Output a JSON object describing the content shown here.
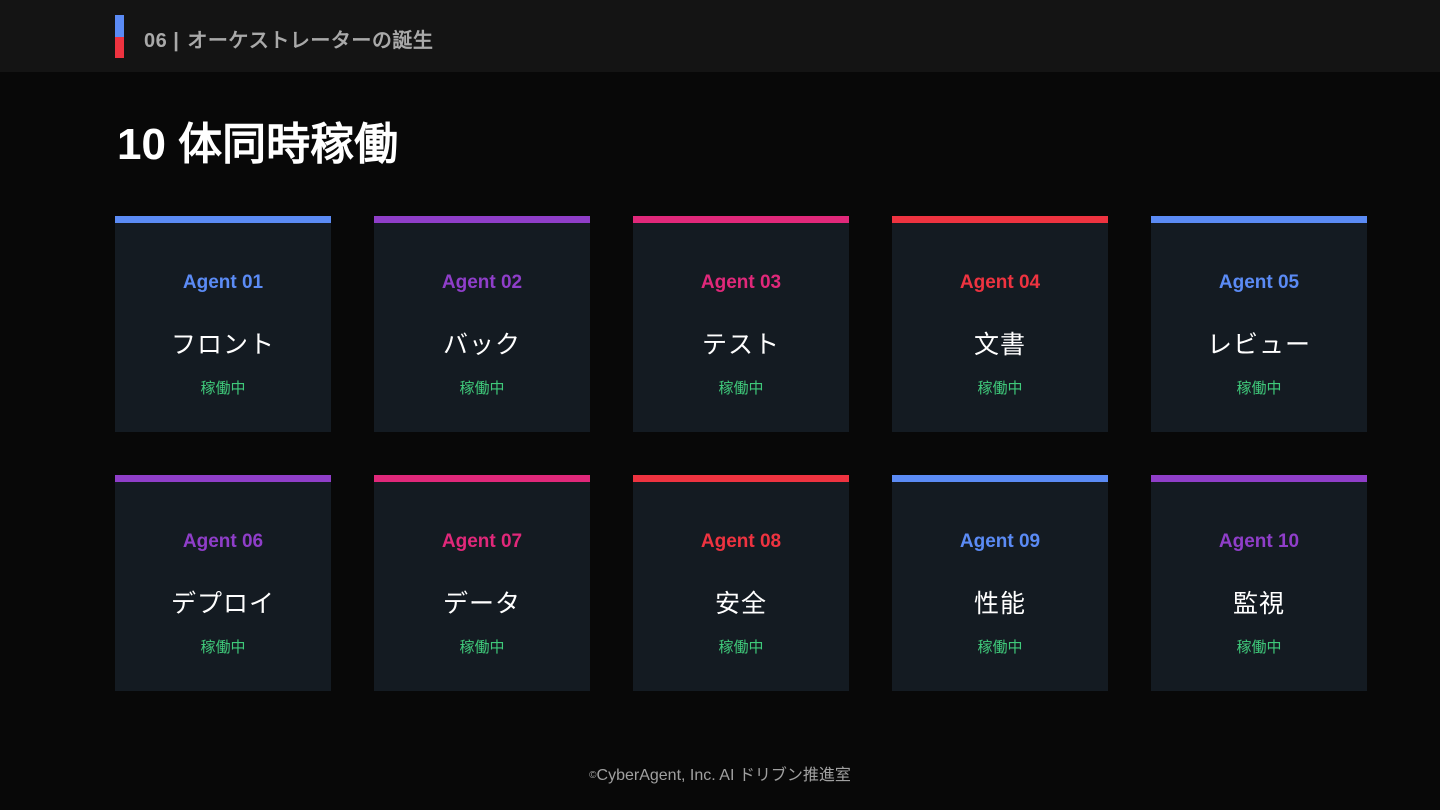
{
  "header": {
    "section_number": "06",
    "separator": "|",
    "section_title": "オーケストレーターの誕生",
    "accent_colors": [
      "#5b8bf5",
      "#ee3340"
    ]
  },
  "title": "10 体同時稼働",
  "agents": [
    {
      "name": "Agent 01",
      "role": "フロント",
      "status": "稼働中",
      "color": "#5b8bf5"
    },
    {
      "name": "Agent 02",
      "role": "バック",
      "status": "稼働中",
      "color": "#8f3ec9"
    },
    {
      "name": "Agent 03",
      "role": "テスト",
      "status": "稼働中",
      "color": "#e0287a"
    },
    {
      "name": "Agent 04",
      "role": "文書",
      "status": "稼働中",
      "color": "#ee3340"
    },
    {
      "name": "Agent 05",
      "role": "レビュー",
      "status": "稼働中",
      "color": "#5b8bf5"
    },
    {
      "name": "Agent 06",
      "role": "デプロイ",
      "status": "稼働中",
      "color": "#8f3ec9"
    },
    {
      "name": "Agent 07",
      "role": "データ",
      "status": "稼働中",
      "color": "#e0287a"
    },
    {
      "name": "Agent 08",
      "role": "安全",
      "status": "稼働中",
      "color": "#ee3340"
    },
    {
      "name": "Agent 09",
      "role": "性能",
      "status": "稼働中",
      "color": "#5b8bf5"
    },
    {
      "name": "Agent 10",
      "role": "監視",
      "status": "稼働中",
      "color": "#8f3ec9"
    }
  ],
  "status_color": "#3fc97a",
  "footer": {
    "copyright_mark": "©",
    "text": "CyberAgent, Inc. AI ドリブン推進室"
  }
}
